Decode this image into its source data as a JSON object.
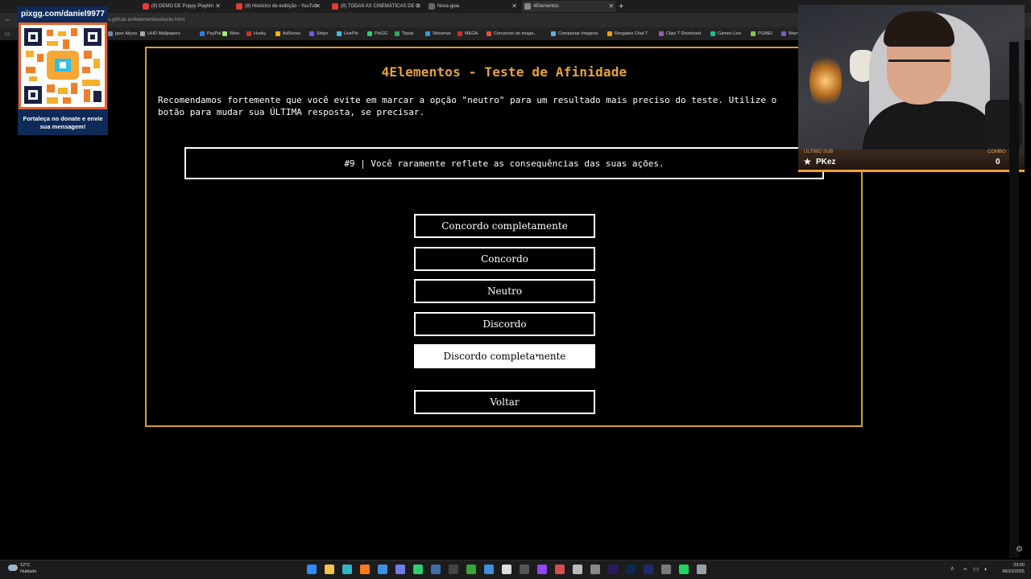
{
  "browser": {
    "tabs": [
      {
        "label": "(8) DEMO DE Poppy Playtim"
      },
      {
        "label": "(8) Histórico de exibição - YouTub"
      },
      {
        "label": "(8) TODAS AS CINEMÁTICAS DE C"
      },
      {
        "label": "Nova guia"
      },
      {
        "label": "4Elementos"
      }
    ],
    "url": "s.github.io/4elementos/teste.html",
    "bookmarks": [
      {
        "label": "pper Abyss",
        "color": "#6a8caf"
      },
      {
        "label": "UHD Wallpapers",
        "color": "#aaaaaa"
      },
      {
        "label": "PayPal",
        "color": "#2f7bd8"
      },
      {
        "label": "Wise",
        "color": "#9fe870"
      },
      {
        "label": "Husky",
        "color": "#c0392b"
      },
      {
        "label": "AdSense",
        "color": "#f4b400"
      },
      {
        "label": "Stripe",
        "color": "#635bff"
      },
      {
        "label": "LivePix",
        "color": "#34c3eb"
      },
      {
        "label": "PixGG",
        "color": "#2ecc71"
      },
      {
        "label": "Tipsal",
        "color": "#27ae60"
      },
      {
        "label": "Streamar",
        "color": "#3498db"
      },
      {
        "label": "MEGA",
        "color": "#d9272e"
      },
      {
        "label": "Conversor de image...",
        "color": "#e74c3c"
      },
      {
        "label": "Compactar Imagens",
        "color": "#5dade2"
      },
      {
        "label": "Resgates Chat T",
        "color": "#f39c12"
      },
      {
        "label": "Clips T Download",
        "color": "#9b59b6"
      },
      {
        "label": "Games Live",
        "color": "#1abc9c"
      },
      {
        "label": "PGMEI",
        "color": "#8bc34a"
      },
      {
        "label": "Warn",
        "color": "#7e57c2"
      }
    ]
  },
  "page": {
    "title": "4Elementos - Teste de Afinidade",
    "intro": "Recomendamos fortemente que você evite em marcar a opção \"neutro\" para um resultado mais preciso do teste. Utilize o botão para mudar sua ÚLTIMA resposta, se precisar.",
    "question": "#9 | Você raramente reflete as consequências das suas ações.",
    "options": [
      "Concordo completamente",
      "Concordo",
      "Neutro",
      "Discordo",
      "Discordo completamente"
    ],
    "back_label": "Voltar"
  },
  "overlay": {
    "qr_header": "pixgg.com/daniel9977",
    "qr_footer": "Fortaleça no donate e envie sua mensagem!",
    "sub_label": "ÚLTIMO SUB",
    "sub_name": "PKez",
    "combo_label": "COMBO",
    "combo_value": "0"
  },
  "taskbar": {
    "weather_temp": "12°C",
    "weather_desc": "Nublado",
    "time": "23:00",
    "date": "06/10/2025",
    "apps": [
      {
        "name": "windows-start-icon",
        "color": "#2f8cff"
      },
      {
        "name": "file-explorer-icon",
        "color": "#f2c14e"
      },
      {
        "name": "edge-icon",
        "color": "#2fb6c9"
      },
      {
        "name": "firefox-icon",
        "color": "#ff7a1a"
      },
      {
        "name": "store-icon",
        "color": "#3d8fe0"
      },
      {
        "name": "discord-icon",
        "color": "#6c7ee8"
      },
      {
        "name": "whatsapp-icon",
        "color": "#2ecc71"
      },
      {
        "name": "steam-icon",
        "color": "#3c6ea8"
      },
      {
        "name": "epic-icon",
        "color": "#444444"
      },
      {
        "name": "xbox-icon",
        "color": "#3aa435"
      },
      {
        "name": "mail-icon",
        "color": "#3c8ede"
      },
      {
        "name": "chrome-icon",
        "color": "#dddddd"
      },
      {
        "name": "obs-icon",
        "color": "#555555"
      },
      {
        "name": "twitch-icon",
        "color": "#9146ff"
      },
      {
        "name": "photos-icon",
        "color": "#d34f4f"
      },
      {
        "name": "github-icon",
        "color": "#bbbbbb"
      },
      {
        "name": "terminal-icon",
        "color": "#888888"
      },
      {
        "name": "premiere-icon",
        "color": "#2b1a5c"
      },
      {
        "name": "photoshop-icon",
        "color": "#0b2a4d"
      },
      {
        "name": "media-encoder-icon",
        "color": "#1f2a6b"
      },
      {
        "name": "calculator-icon",
        "color": "#7a7a7a"
      },
      {
        "name": "spotify-icon",
        "color": "#1ed760"
      },
      {
        "name": "settings-icon",
        "color": "#9aa0a6"
      }
    ]
  }
}
